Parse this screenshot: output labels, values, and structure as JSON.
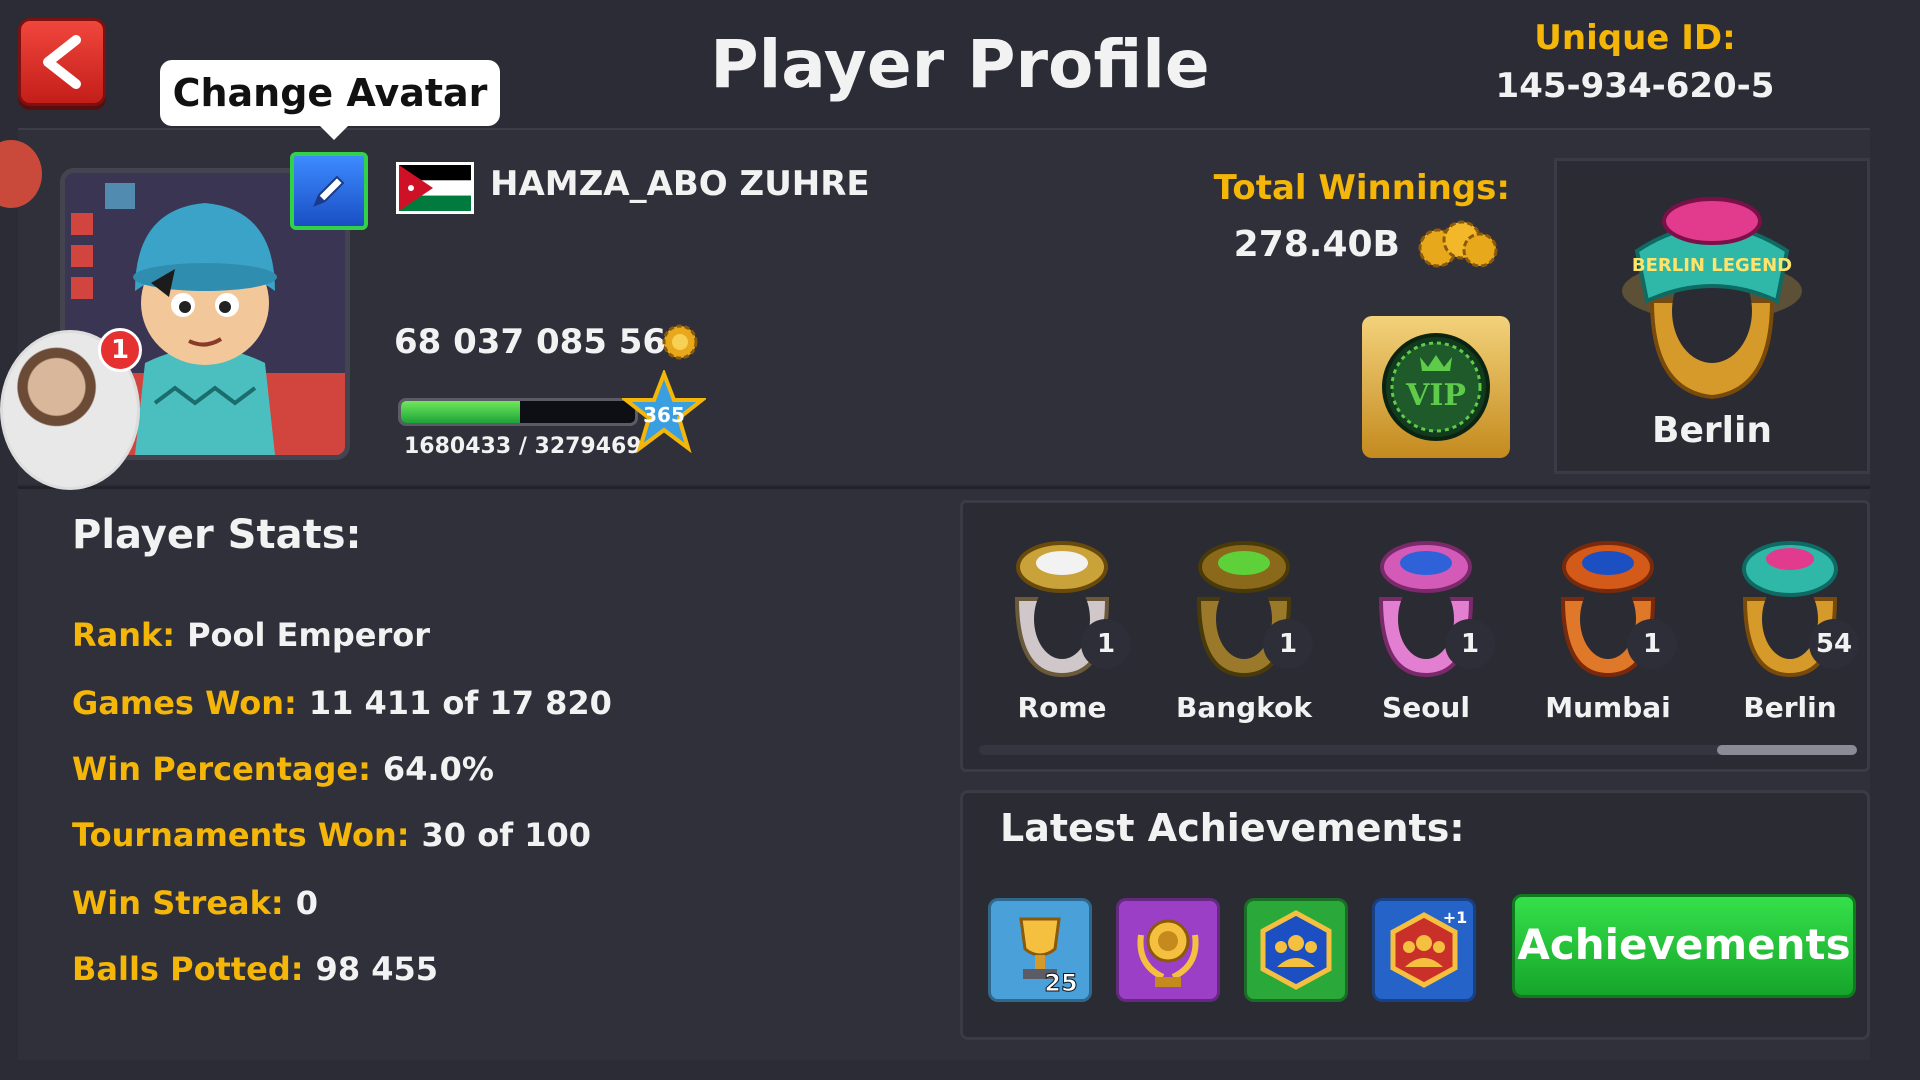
{
  "header": {
    "title": "Player Profile",
    "unique_id_label": "Unique ID:",
    "unique_id_value": "145-934-620-5",
    "back_icon": "back-arrow-icon"
  },
  "profile": {
    "tooltip": "Change Avatar",
    "username": "HAMZA_ABO ZUHRE",
    "coins": "68 037 085 560",
    "xp_text": "1680433 / 3279469",
    "xp_fraction": 0.51,
    "level": "365",
    "notification_count": "1",
    "flag": "jordan-flag-icon"
  },
  "winnings": {
    "label": "Total Winnings:",
    "value": "278.40B",
    "vip_text": "VIP"
  },
  "league": {
    "name": "Berlin"
  },
  "stats": {
    "title": "Player Stats:",
    "rows": [
      {
        "key": "Rank:",
        "value": "Pool Emperor"
      },
      {
        "key": "Games Won:",
        "value": "11 411 of 17 820"
      },
      {
        "key": "Win Percentage:",
        "value": "64.0%"
      },
      {
        "key": "Tournaments Won:",
        "value": "30 of 100"
      },
      {
        "key": "Win Streak:",
        "value": "0"
      },
      {
        "key": "Balls Potted:",
        "value": "98 455"
      }
    ]
  },
  "rings": [
    {
      "name": "Rome",
      "count": "1",
      "color": "#cfc7c9",
      "gem": "#f2f2f2"
    },
    {
      "name": "Bangkok",
      "count": "1",
      "color": "#9a7a2a",
      "gem": "#5ed13a"
    },
    {
      "name": "Seoul",
      "count": "1",
      "color": "#e37fd0",
      "gem": "#2f62d9"
    },
    {
      "name": "Mumbai",
      "count": "1",
      "color": "#e0782a",
      "gem": "#1c4fc2"
    },
    {
      "name": "Berlin",
      "count": "54",
      "color": "#d59a2a",
      "gem": "#e23a8c"
    }
  ],
  "achievements": {
    "title": "Latest Achievements:",
    "button": "Achievements",
    "tiles": [
      {
        "icon": "trophy-icon",
        "color": "#4aa0d8",
        "text": "25"
      },
      {
        "icon": "laurel-trophy-icon",
        "color": "#9b3fc7",
        "text": ""
      },
      {
        "icon": "team-hexagon-icon",
        "color": "#2aa83a",
        "text": ""
      },
      {
        "icon": "team-hexagon-plus-icon",
        "color": "#2563c9",
        "text": "+1"
      }
    ]
  }
}
